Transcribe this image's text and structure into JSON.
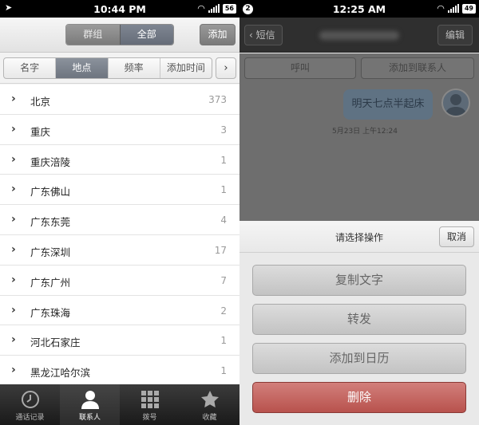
{
  "left": {
    "status": {
      "time": "10:44 PM",
      "battery": "56"
    },
    "header": {
      "seg_group": "群组",
      "seg_all": "全部",
      "add": "添加"
    },
    "sort": {
      "tabs": [
        "名字",
        "地点",
        "频率",
        "添加时间"
      ],
      "active": "地点",
      "more": "›"
    },
    "rows": [
      {
        "name": "北京",
        "count": "373"
      },
      {
        "name": "重庆",
        "count": "3"
      },
      {
        "name": "重庆涪陵",
        "count": "1"
      },
      {
        "name": "广东佛山",
        "count": "1"
      },
      {
        "name": "广东东莞",
        "count": "4"
      },
      {
        "name": "广东深圳",
        "count": "17"
      },
      {
        "name": "广东广州",
        "count": "7"
      },
      {
        "name": "广东珠海",
        "count": "2"
      },
      {
        "name": "河北石家庄",
        "count": "1"
      },
      {
        "name": "黑龙江哈尔滨",
        "count": "1"
      }
    ],
    "tabs": [
      {
        "label": "通话记录",
        "icon": "clock-icon"
      },
      {
        "label": "联系人",
        "icon": "person-icon"
      },
      {
        "label": "拨号",
        "icon": "dialpad-icon"
      },
      {
        "label": "收藏",
        "icon": "star-icon"
      }
    ]
  },
  "right": {
    "status": {
      "badge": "2",
      "time": "12:25 AM",
      "battery": "49"
    },
    "header": {
      "back": "短信",
      "edit": "编辑"
    },
    "actions": {
      "call": "呼叫",
      "add_contact": "添加到联系人"
    },
    "message": {
      "text": "明天七点半起床",
      "time": "5月23日 上午12:24"
    },
    "sheet": {
      "title": "请选择操作",
      "cancel": "取消",
      "buttons": [
        "复制文字",
        "转发",
        "添加到日历",
        "删除"
      ]
    }
  },
  "colors": {
    "delete": "#c0605b",
    "dark_header": "#2f2f2f"
  }
}
